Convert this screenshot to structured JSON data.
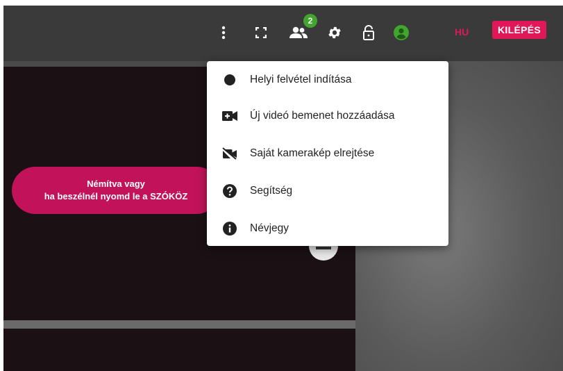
{
  "topbar": {
    "participants_count": "2",
    "language": "HU",
    "exit_label": "KILÉPÉS",
    "icons": [
      "more-vert-icon",
      "fullscreen-icon",
      "participants-icon",
      "gear-icon",
      "lock-open-icon",
      "user-avatar-icon"
    ]
  },
  "menu": {
    "items": [
      {
        "label": "Helyi felvétel indítása",
        "icon": "record-icon"
      },
      {
        "label": "Új videó bemenet hozzáadása",
        "icon": "add-video-icon"
      },
      {
        "label": "Saját kamerakép elrejtése",
        "icon": "video-off-icon"
      },
      {
        "label": "Segítség",
        "icon": "help-icon"
      },
      {
        "label": "Névjegy",
        "icon": "info-icon"
      }
    ]
  },
  "mute_notice": {
    "line1": "Némítva vagy",
    "line2": "ha beszélnél nyomd le a SZÓKÖZ"
  },
  "colors": {
    "accent": "#e0185a",
    "badge": "#42a52f",
    "mute_pill": "#c2135a",
    "topbar": "#3a3a3a"
  }
}
